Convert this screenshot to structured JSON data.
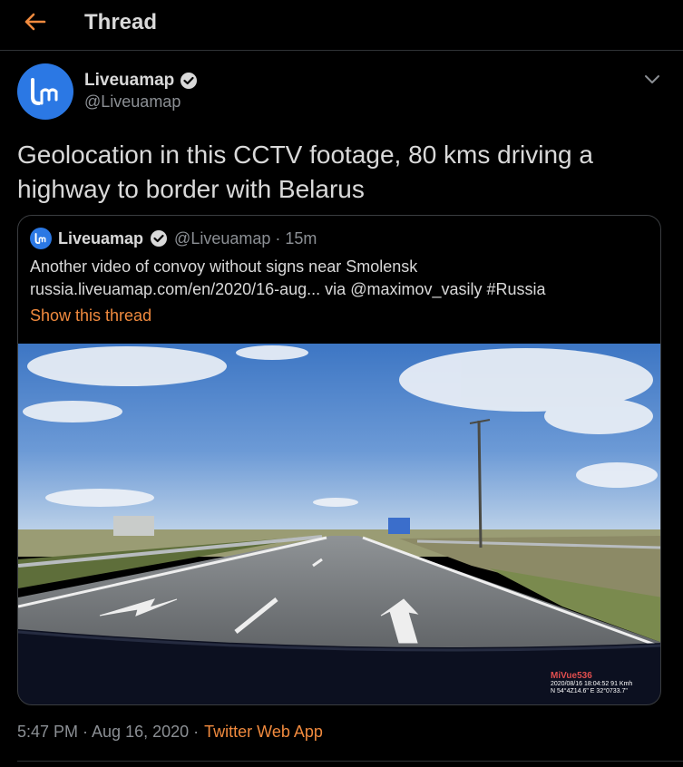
{
  "header": {
    "title": "Thread",
    "back_icon": "arrow-left-icon"
  },
  "tweet": {
    "avatar_icon": "liveuamap-logo",
    "display_name": "Liveuamap",
    "verified_icon": "verified-badge-icon",
    "handle": "@Liveuamap",
    "more_icon": "chevron-down-icon",
    "text": "Geolocation in this CCTV footage, 80 kms driving a highway to border with Belarus"
  },
  "quote": {
    "display_name": "Liveuamap",
    "handle_time": "@Liveuamap · 15m",
    "line1": "Another video of convoy without signs near Smolensk",
    "line2": "russia.liveuamap.com/en/2020/16-aug...   via @maximov_vasily #Russia",
    "show_thread": "Show this thread",
    "dashcam": {
      "brand": "MiVue536",
      "datetime_speed": "2020/08/16 18:04:52  91 Kmh",
      "coords": "N 54°4Z14.6\"  E   32°0733.7\""
    }
  },
  "footer": {
    "time_date": "5:47 PM · Aug 16, 2020 ·",
    "app": "Twitter Web App"
  },
  "colors": {
    "accent": "#f08a3e",
    "avatar": "#2b78e4",
    "background": "#000000"
  }
}
